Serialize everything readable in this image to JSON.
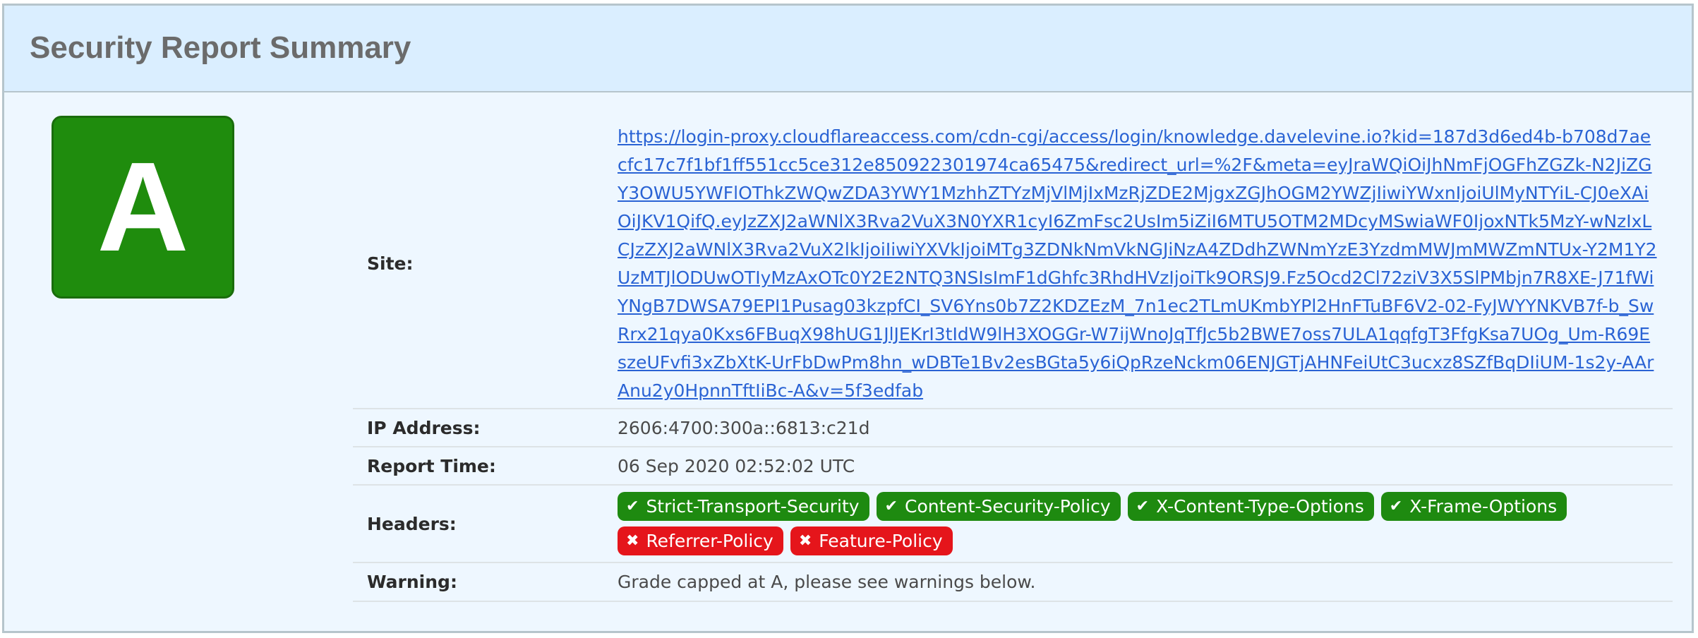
{
  "panel": {
    "title": "Security Report Summary"
  },
  "grade": {
    "letter": "A",
    "color": "#1f8c0d"
  },
  "rows": {
    "site": {
      "label": "Site:",
      "url": "https://login-proxy.cloudflareaccess.com/cdn-cgi/access/login/knowledge.davelevine.io?kid=187d3d6ed4b-b708d7aecfc17c7f1bf1ff551cc5ce312e850922301974ca65475&redirect_url=%2F&meta=eyJraWQiOiJhNmFjOGFhZGZk-N2JiZGY3OWU5YWFlOThkZWQwZDA3YWY1MzhhZTYzMjVlMjIxMzRjZDE2MjgxZGJhOGM2YWZjIiwiYWxnIjoiUlMyNTYiL-CJ0eXAiOiJKV1QifQ.eyJzZXJ2aWNlX3Rva2VuX3N0YXR1cyI6ZmFsc2UsIm5iZiI6MTU5OTM2MDcyMSwiaWF0IjoxNTk5MzY-wNzIxLCJzZXJ2aWNlX3Rva2VuX2lkIjoiIiwiYXVkIjoiMTg3ZDNkNmVkNGJiNzA4ZDdhZWNmYzE3YzdmMWJmMWZmNTUx-Y2M1Y2UzMTJlODUwOTIyMzAxOTc0Y2E2NTQ3NSIsImF1dGhfc3RhdHVzIjoiTk9ORSJ9.Fz5Ocd2Cl72ziV3X5SlPMbjn7R8XE-J71fWiYNgB7DWSA79EPI1Pusag03kzpfCI_SV6Yns0b7Z2KDZEzM_7n1ec2TLmUKmbYPl2HnFTuBF6V2-02-FyJWYYNKVB7f-b_SwRrx21qya0Kxs6FBuqX98hUG1JlJEKrI3tIdW9lH3XOGGr-W7ijWnoJqTfJc5b2BWE7oss7ULA1qqfgT3FfgKsa7UOg_Um-R69EszeUFvfi3xZbXtK-UrFbDwPm8hn_wDBTe1Bv2esBGta5y6iQpRzeNckm06ENJGTjAHNFeiUtC3ucxz8SZfBqDIiUM-1s2y-AArAnu2y0HpnnTftIiBc-A&v=5f3edfab"
    },
    "ip": {
      "label": "IP Address:",
      "value": "2606:4700:300a::6813:c21d"
    },
    "time": {
      "label": "Report Time:",
      "value": "06 Sep 2020 02:52:02 UTC"
    },
    "headers": {
      "label": "Headers:",
      "badges": [
        {
          "text": "Strict-Transport-Security",
          "status": "ok",
          "icon": "check-icon"
        },
        {
          "text": "Content-Security-Policy",
          "status": "ok",
          "icon": "check-icon"
        },
        {
          "text": "X-Content-Type-Options",
          "status": "ok",
          "icon": "check-icon"
        },
        {
          "text": "X-Frame-Options",
          "status": "ok",
          "icon": "check-icon"
        },
        {
          "text": "Referrer-Policy",
          "status": "bad",
          "icon": "cross-icon"
        },
        {
          "text": "Feature-Policy",
          "status": "bad",
          "icon": "cross-icon"
        }
      ]
    },
    "warning": {
      "label": "Warning:",
      "value": "Grade capped at A, please see warnings below."
    }
  },
  "colors": {
    "ok": "#1e8a10",
    "bad": "#e5151b",
    "link": "#2a63d4"
  }
}
